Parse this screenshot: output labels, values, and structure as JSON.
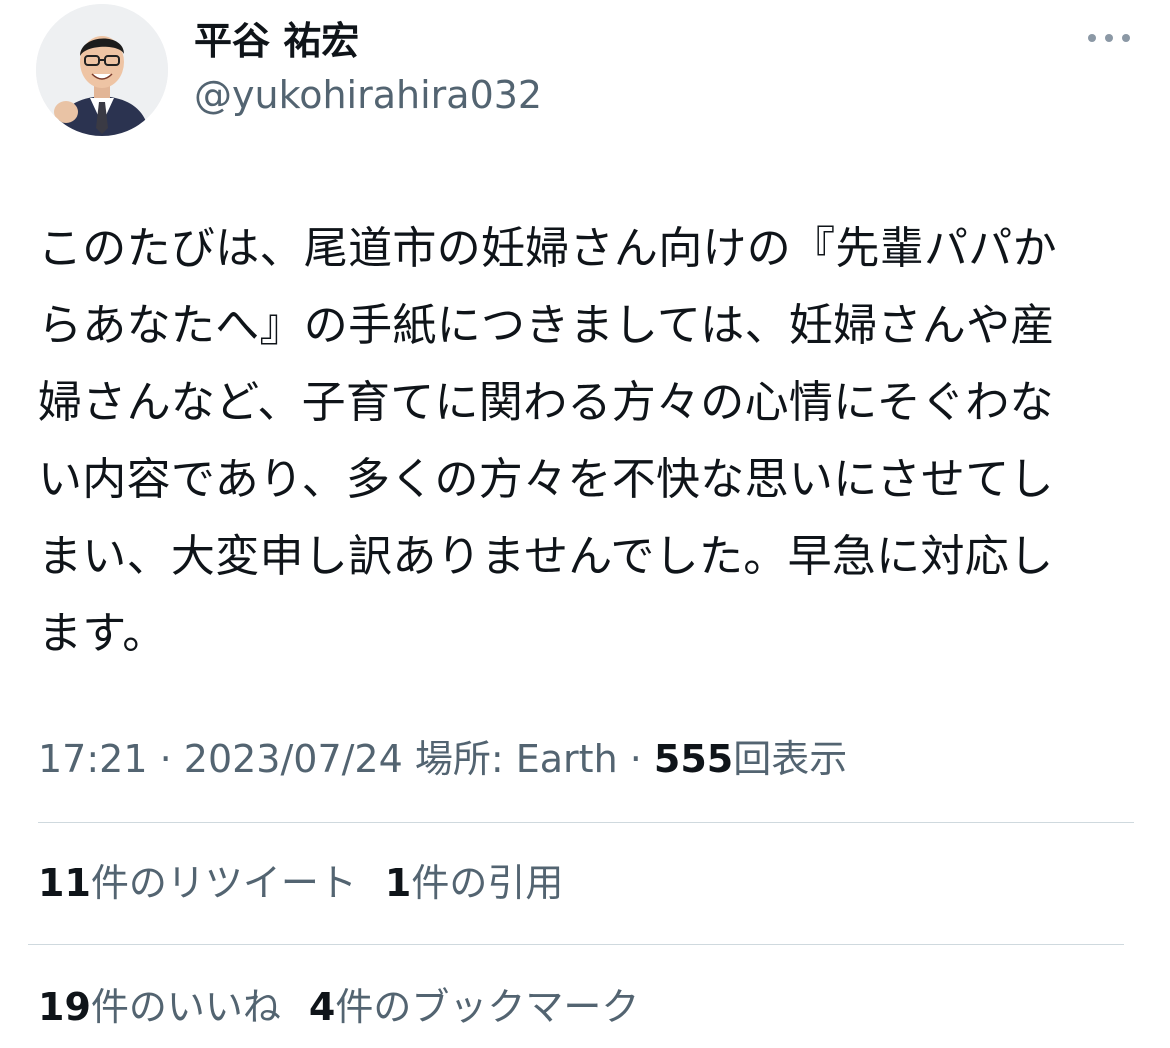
{
  "author": {
    "display_name": "平谷 祐宏",
    "handle": "@yukohirahira032",
    "avatar_icon": "avatar-photo"
  },
  "more_icon": "more-horizontal-icon",
  "tweet": {
    "text": "このたびは、尾道市の妊婦さん向けの『先輩パパか\nらあなたへ』の手紙につきましては、妊婦さんや産\n婦さんなど、子育てに関わる方々の心情にそぐわな\nい内容であり、多くの方々を不快な思いにさせてし\nまい、大変申し訳ありませんでした。早急に対応し\nます。"
  },
  "meta": {
    "time": "17:21",
    "sep1": " · ",
    "date": "2023/07/24",
    "location": " 場所: Earth",
    "sep2": " · ",
    "views_count": "555",
    "views_label": "回表示"
  },
  "stats": {
    "retweets": {
      "count": "11",
      "label": "件のリツイート"
    },
    "quotes": {
      "count": "1",
      "label": "件の引用"
    },
    "likes": {
      "count": "19",
      "label": "件のいいね"
    },
    "bookmarks": {
      "count": "4",
      "label": "件のブックマーク"
    }
  },
  "colors": {
    "text_primary": "#0f1419",
    "text_secondary": "#536471",
    "divider": "#cfd9de"
  }
}
